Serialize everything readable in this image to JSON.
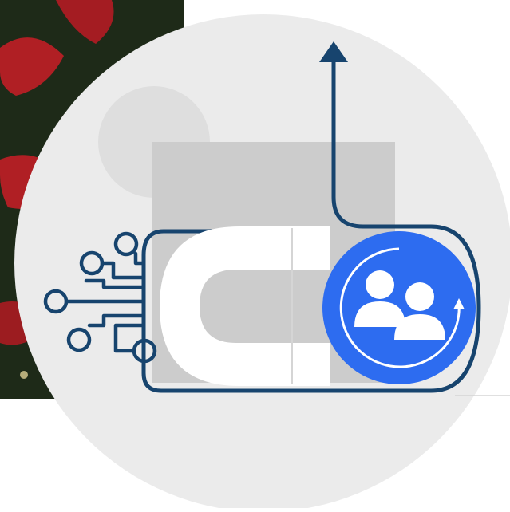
{
  "colors": {
    "background": "#ffffff",
    "circle": "#ebebeb",
    "placeholder_gray": "#cccccc",
    "placeholder_circle": "#dedede",
    "line_navy": "#17446e",
    "accent_blue": "#2d6cf0",
    "white": "#ffffff",
    "photo_dark": "#1e2a18",
    "photo_red": "#b01f24"
  },
  "icons": {
    "magnet": "magnet-icon",
    "circuit": "circuit-branch-icon",
    "users": "users-icon",
    "refresh": "circular-refresh-arrow-icon",
    "arrow_up": "arrow-up-icon"
  }
}
